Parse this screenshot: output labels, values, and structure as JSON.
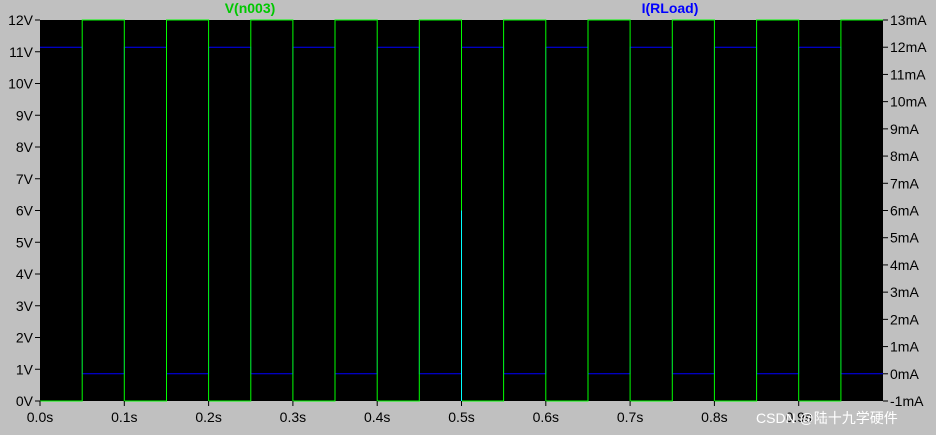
{
  "chart_data": {
    "type": "line",
    "colors": {
      "background": "#000000",
      "frame": "#c0c0c0",
      "voltage": "#00ff00",
      "current": "#0000ff",
      "glitch": "#00ffff"
    },
    "x_ticks": [
      "0.0s",
      "0.1s",
      "0.2s",
      "0.3s",
      "0.4s",
      "0.5s",
      "0.6s",
      "0.7s",
      "0.8s",
      "0.9s"
    ],
    "y_left_ticks": [
      "0V",
      "1V",
      "2V",
      "3V",
      "4V",
      "5V",
      "6V",
      "7V",
      "8V",
      "9V",
      "10V",
      "11V",
      "12V"
    ],
    "y_right_ticks": [
      "-1mA",
      "0mA",
      "1mA",
      "2mA",
      "3mA",
      "4mA",
      "5mA",
      "6mA",
      "7mA",
      "8mA",
      "9mA",
      "10mA",
      "11mA",
      "12mA",
      "13mA"
    ],
    "xlim": [
      0,
      1.0
    ],
    "ylim_left": [
      0,
      12
    ],
    "ylim_right": [
      -1,
      13
    ],
    "series": [
      {
        "name": "V(n003)",
        "axis": "left",
        "period": 0.1,
        "high_start": 0.05,
        "low": 0,
        "high": 12
      },
      {
        "name": "I(RLoad)",
        "axis": "right",
        "period": 0.1,
        "high_start": 0.0,
        "low": 0.0,
        "high": 12.0
      }
    ],
    "annotations": [
      {
        "type": "spike",
        "x": 0.5,
        "y_from": 0,
        "y_to": 6
      }
    ],
    "watermark": "CSDN @陆十九学硬件"
  }
}
